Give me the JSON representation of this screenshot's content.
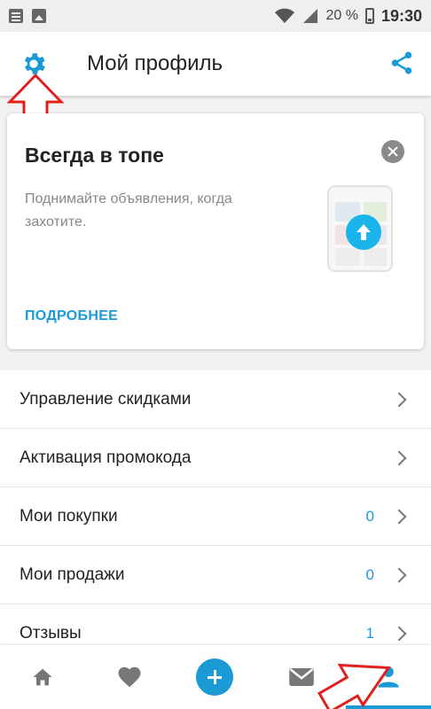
{
  "status_bar": {
    "battery": "20 %",
    "time": "19:30"
  },
  "app_bar": {
    "title": "Мой профиль",
    "icons": [
      "gear-icon",
      "share-icon"
    ]
  },
  "promo_card": {
    "title": "Всегда в топе",
    "text": "Поднимайте объявления, когда захотите.",
    "link": "ПОДРОБНЕЕ"
  },
  "menu": {
    "items": [
      {
        "label": "Управление скидками",
        "count": ""
      },
      {
        "label": "Активация промокода",
        "count": ""
      },
      {
        "label": "Мои покупки",
        "count": "0"
      },
      {
        "label": "Мои продажи",
        "count": "0"
      },
      {
        "label": "Отзывы",
        "count": "1"
      }
    ]
  },
  "bottom_nav": {
    "items": [
      "home-icon",
      "favorites-icon",
      "add-icon",
      "messages-icon",
      "profile-icon"
    ],
    "active": "profile-icon"
  },
  "colors": {
    "accent": "#1a9bd6",
    "annotation": "#e0201f"
  }
}
